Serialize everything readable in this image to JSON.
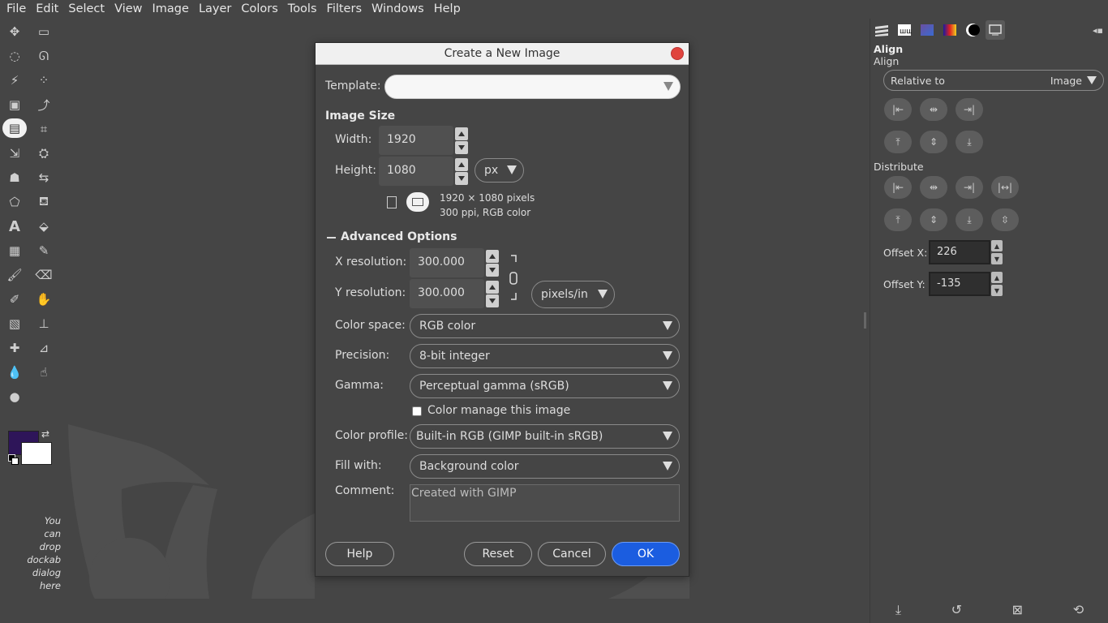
{
  "menubar": [
    "File",
    "Edit",
    "Select",
    "View",
    "Image",
    "Layer",
    "Colors",
    "Tools",
    "Filters",
    "Windows",
    "Help"
  ],
  "toolbox": {
    "drop_hint": "You\ncan\ndrop\ndockab\ndialog\nhere",
    "fg_color": "#2e1559",
    "bg_color": "#ffffff"
  },
  "dock": {
    "title": "Align",
    "subtitle": "Align",
    "relative_label": "Relative to",
    "relative_value": "Image",
    "distribute_label": "Distribute",
    "offset_x_label": "Offset X:",
    "offset_x_value": "226",
    "offset_y_label": "Offset Y:",
    "offset_y_value": "-135"
  },
  "dialog": {
    "title": "Create a New Image",
    "template_label": "Template:",
    "template_value": "",
    "image_size_heading": "Image Size",
    "width_label": "Width:",
    "width_value": "1920",
    "height_label": "Height:",
    "height_value": "1080",
    "size_unit": "px",
    "info_line1": "1920 × 1080 pixels",
    "info_line2": "300 ppi, RGB color",
    "advanced_heading": "Advanced Options",
    "xres_label": "X resolution:",
    "xres_value": "300.000",
    "yres_label": "Y resolution:",
    "yres_value": "300.000",
    "res_unit": "pixels/in",
    "color_space_label": "Color space:",
    "color_space_value": "RGB color",
    "precision_label": "Precision:",
    "precision_value": "8-bit integer",
    "gamma_label": "Gamma:",
    "gamma_value": "Perceptual gamma (sRGB)",
    "color_manage_label": "Color manage this image",
    "color_profile_label": "Color profile:",
    "color_profile_value": "Built-in RGB (GIMP built-in sRGB)",
    "fill_label": "Fill with:",
    "fill_value": "Background color",
    "comment_label": "Comment:",
    "comment_value": "Created with GIMP",
    "help_button": "Help",
    "reset_button": "Reset",
    "cancel_button": "Cancel",
    "ok_button": "OK"
  },
  "colors": {
    "accent": "#1b5de0",
    "close": "#e0443e"
  }
}
